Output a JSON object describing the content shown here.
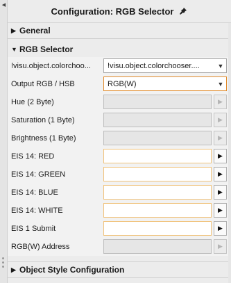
{
  "panel": {
    "title": "Configuration: RGB Selector",
    "collapse_glyph": "◀",
    "pin_icon": "pin-icon"
  },
  "sections": {
    "general": {
      "label": "General",
      "arrow": "▶"
    },
    "rgb": {
      "label": "RGB Selector",
      "arrow": "▼"
    },
    "style": {
      "label": "Object Style Configuration",
      "arrow": "▶"
    }
  },
  "rows": {
    "object": {
      "label": "!visu.object.colorchoo...",
      "value": "!visu.object.colorchooser...."
    },
    "output": {
      "label": "Output RGB / HSB",
      "value": "RGB(W)"
    },
    "hue": {
      "label": "Hue (2 Byte)"
    },
    "saturation": {
      "label": "Saturation (1 Byte)"
    },
    "brightness": {
      "label": "Brightness (1 Byte)"
    },
    "red": {
      "label": "EIS 14: RED"
    },
    "green": {
      "label": "EIS 14: GREEN"
    },
    "blue": {
      "label": "EIS 14: BLUE"
    },
    "white": {
      "label": "EIS 14: WHITE"
    },
    "submit": {
      "label": "EIS 1 Submit"
    },
    "address": {
      "label": "RGB(W) Address"
    }
  },
  "glyphs": {
    "play": "▶",
    "dropdown": "▼"
  },
  "colors": {
    "focus_border": "#e08a2a",
    "active_border": "#f0c27a"
  }
}
